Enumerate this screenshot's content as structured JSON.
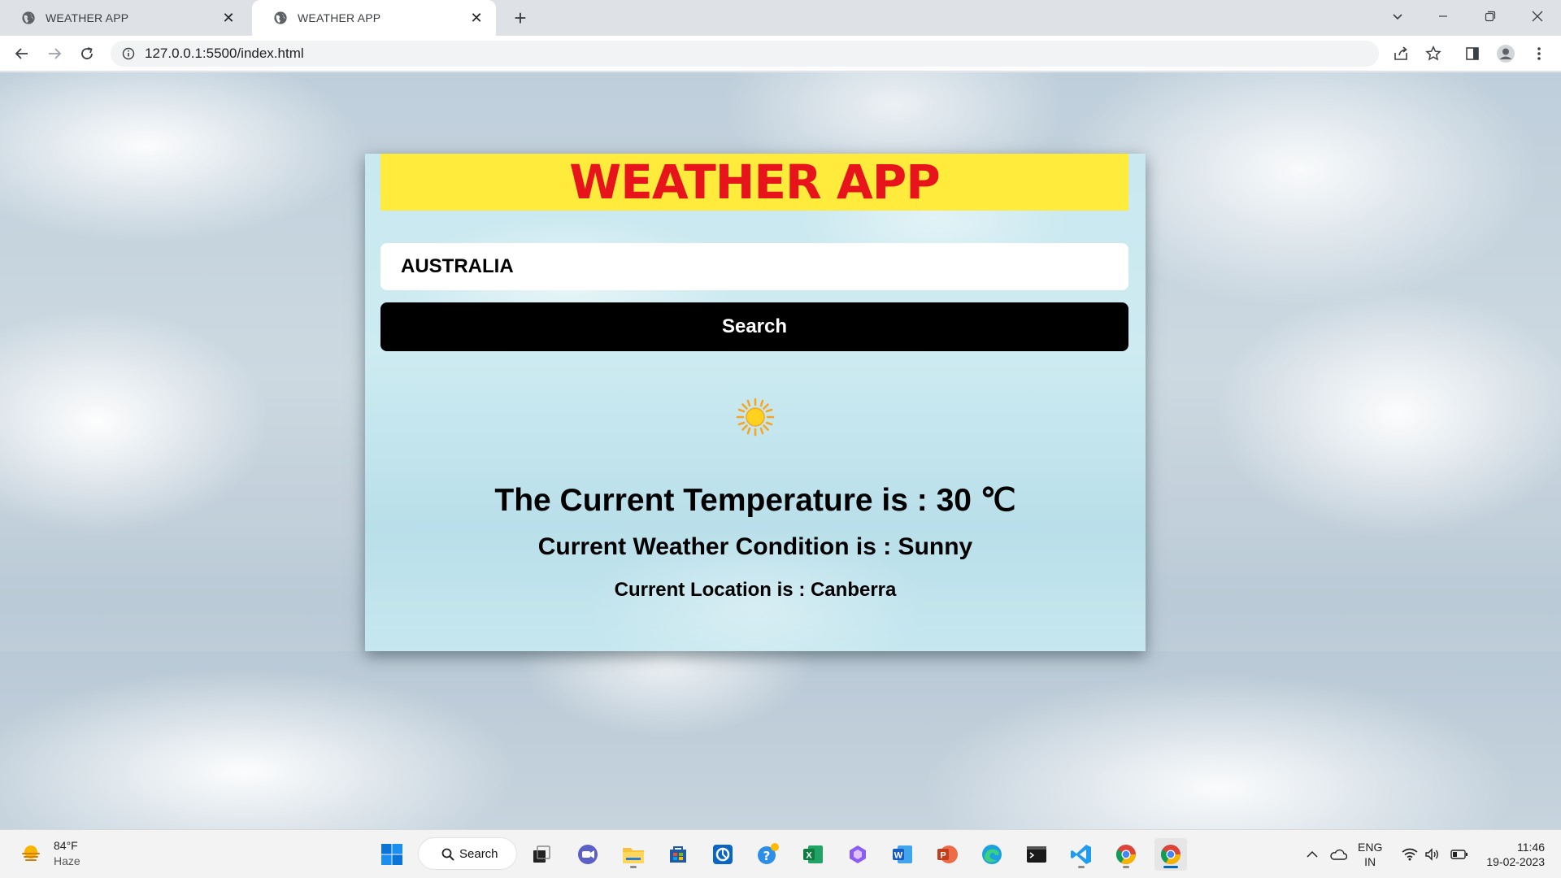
{
  "browser": {
    "tabs": [
      {
        "title": "WEATHER APP",
        "active": false
      },
      {
        "title": "WEATHER APP",
        "active": true
      }
    ],
    "url": "127.0.0.1:5500/index.html"
  },
  "app": {
    "title": "WEATHER APP",
    "search_value": "AUSTRALIA",
    "search_button": "Search",
    "weather_icon": "sun-icon",
    "temperature_text": "The Current Temperature is : 30 ℃",
    "condition_text": "Current Weather Condition is : Sunny",
    "location_text": "Current Location is : Canberra"
  },
  "taskbar": {
    "weather": {
      "temp": "84°F",
      "condition": "Haze"
    },
    "search_label": "Search",
    "apps": [
      "start-icon",
      "search",
      "task-view-icon",
      "meet-icon",
      "file-explorer-icon",
      "store-icon",
      "app-icon",
      "tips-icon",
      "excel-icon",
      "copilot-icon",
      "word-icon",
      "powerpoint-icon",
      "edge-icon",
      "terminal-icon",
      "vscode-icon",
      "chrome-icon",
      "chrome-icon"
    ],
    "language": {
      "line1": "ENG",
      "line2": "IN"
    },
    "time": "11:46",
    "date": "19-02-2023"
  },
  "colors": {
    "title_bg": "#ffeb3b",
    "title_text": "#e8141b",
    "button_bg": "#000000"
  }
}
